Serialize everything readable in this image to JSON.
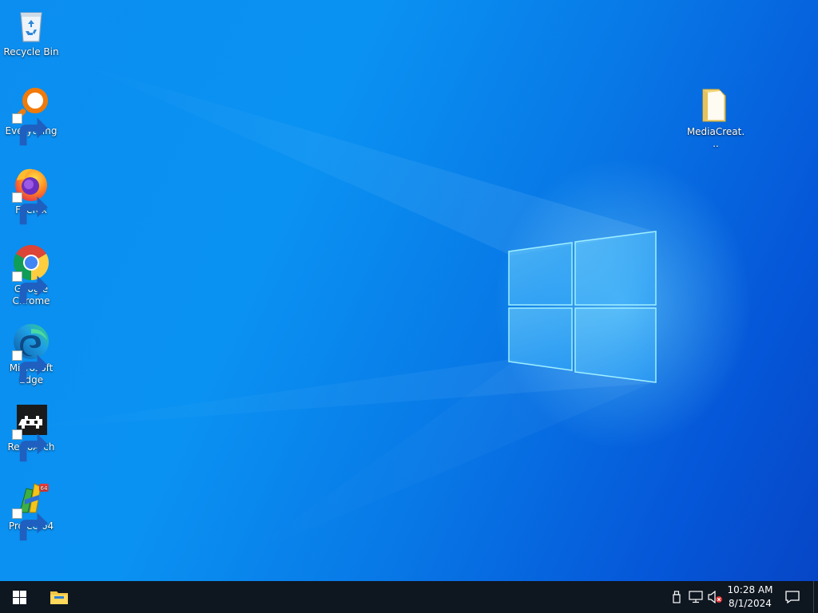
{
  "desktop": {
    "icons": [
      {
        "label": "Recycle Bin",
        "icon": "recycle-bin-icon"
      },
      {
        "label": "Everything",
        "icon": "everything-search-icon"
      },
      {
        "label": "Firefox",
        "icon": "firefox-icon"
      },
      {
        "label": "Google Chrome",
        "icon": "chrome-icon"
      },
      {
        "label": "Microsoft Edge",
        "icon": "edge-icon"
      },
      {
        "label": "RetroArch",
        "icon": "retroarch-icon"
      },
      {
        "label": "Project64",
        "icon": "project64-icon"
      },
      {
        "label": "MediaCreat...",
        "icon": "folder-icon"
      }
    ]
  },
  "taskbar": {
    "start_icon": "windows-start-icon",
    "pinned": [
      {
        "name": "File Explorer",
        "icon": "file-explorer-icon"
      }
    ],
    "tray": {
      "icons": [
        "usb-device-icon",
        "network-icon",
        "volume-muted-icon"
      ],
      "time": "10:28 AM",
      "date": "8/1/2024",
      "notification_icon": "action-center-icon"
    }
  },
  "colors": {
    "wallpaper_blue": "#0a8ff0",
    "taskbar": "#0e1620",
    "accent": "#0078d7"
  }
}
